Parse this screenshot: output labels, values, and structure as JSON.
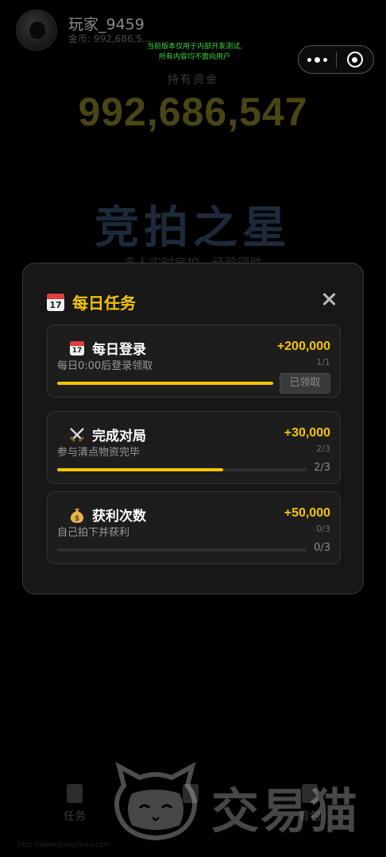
{
  "header": {
    "player_name": "玩家_9459",
    "coin_line": "金币: 992,686,5...",
    "notice_line1": "当前版本仅用于内部开发测试,",
    "notice_line2": "所有内容均不面向用户"
  },
  "funds": {
    "label": "持有资金",
    "value": "992,686,547"
  },
  "game": {
    "title": "竞拍之星",
    "subtitle": "多人实时竞拍 · 经验得胜"
  },
  "modal": {
    "title": "每日任务",
    "title_icon": "calendar-icon",
    "calendar_day": "17",
    "tasks": [
      {
        "name": "每日登录",
        "icon": "calendar-icon",
        "desc": "每日0:00后登录领取",
        "reward": "+200,000",
        "ratio": "1/1",
        "progress": 1.0,
        "action_label": "已领取"
      },
      {
        "name": "完成对局",
        "icon": "crossed-swords-icon",
        "desc": "参与清点物资完毕",
        "reward": "+30,000",
        "ratio": "2/3",
        "progress": 0.667,
        "progress_text": "2/3"
      },
      {
        "name": "获利次数",
        "icon": "money-bag-icon",
        "desc": "自己拍下并获利",
        "reward": "+50,000",
        "ratio": "0/3",
        "progress": 0.0,
        "progress_text": "0/3"
      }
    ]
  },
  "bottom_nav": {
    "items": [
      "任务",
      "",
      "背包"
    ]
  },
  "footer_url": "http://www.jiaoyimao.com",
  "watermark": {
    "text": "交易猫"
  },
  "colors": {
    "accent": "#f5c400",
    "modal_bg": "#171717",
    "card_bg": "#1d1d1d",
    "notice": "#3fd43f"
  }
}
